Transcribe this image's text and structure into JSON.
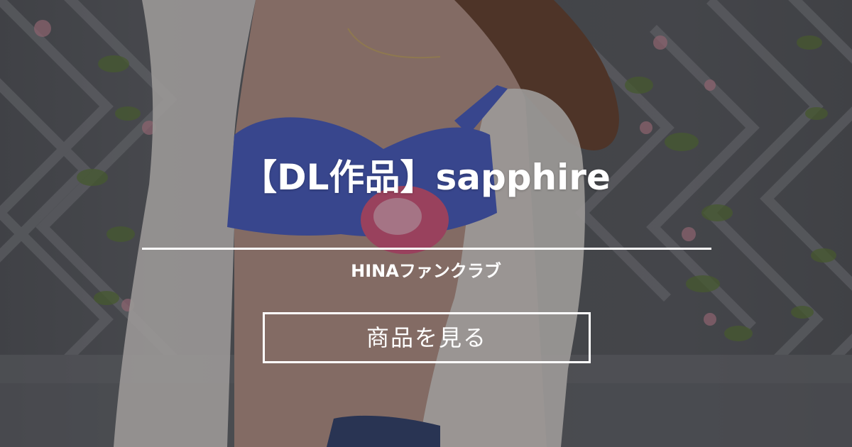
{
  "product": {
    "title": "【DL作品】sapphire",
    "creator": "HINAファンクラブ"
  },
  "actions": {
    "view_label": "商品を見る"
  },
  "colors": {
    "text": "#ffffff",
    "overlay": "rgba(20,20,24,0.32)",
    "bra_blue": "#4a5fc4",
    "flower_pink": "#d9577e",
    "lace": "#e8e4e0",
    "ivy_green": "#5f7a3a"
  },
  "icons": {
    "background": "product-photo"
  }
}
